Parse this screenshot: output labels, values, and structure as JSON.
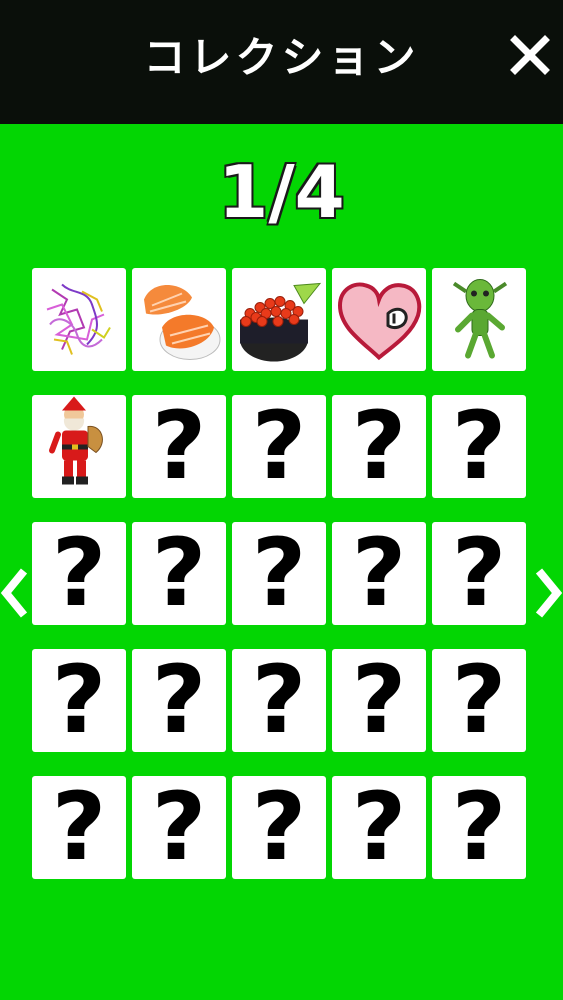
{
  "header": {
    "title": "コレクション",
    "close_icon": "close-icon"
  },
  "pagination": {
    "current": 1,
    "total": 4,
    "label": "1/4",
    "prev_icon": "chevron-left-icon",
    "next_icon": "chevron-right-icon"
  },
  "collection": {
    "locked_label": "?",
    "items": [
      {
        "state": "unlocked",
        "icon": "molecule-icon"
      },
      {
        "state": "unlocked",
        "icon": "salmon-sushi-icon"
      },
      {
        "state": "unlocked",
        "icon": "ikura-sushi-icon"
      },
      {
        "state": "unlocked",
        "icon": "heart-icon"
      },
      {
        "state": "unlocked",
        "icon": "alien-icon"
      },
      {
        "state": "unlocked",
        "icon": "santa-icon"
      },
      {
        "state": "locked"
      },
      {
        "state": "locked"
      },
      {
        "state": "locked"
      },
      {
        "state": "locked"
      },
      {
        "state": "locked"
      },
      {
        "state": "locked"
      },
      {
        "state": "locked"
      },
      {
        "state": "locked"
      },
      {
        "state": "locked"
      },
      {
        "state": "locked"
      },
      {
        "state": "locked"
      },
      {
        "state": "locked"
      },
      {
        "state": "locked"
      },
      {
        "state": "locked"
      },
      {
        "state": "locked"
      },
      {
        "state": "locked"
      },
      {
        "state": "locked"
      },
      {
        "state": "locked"
      },
      {
        "state": "locked"
      }
    ]
  },
  "colors": {
    "background": "#03d603",
    "header": "#0a0f0a",
    "card": "#ffffff"
  }
}
